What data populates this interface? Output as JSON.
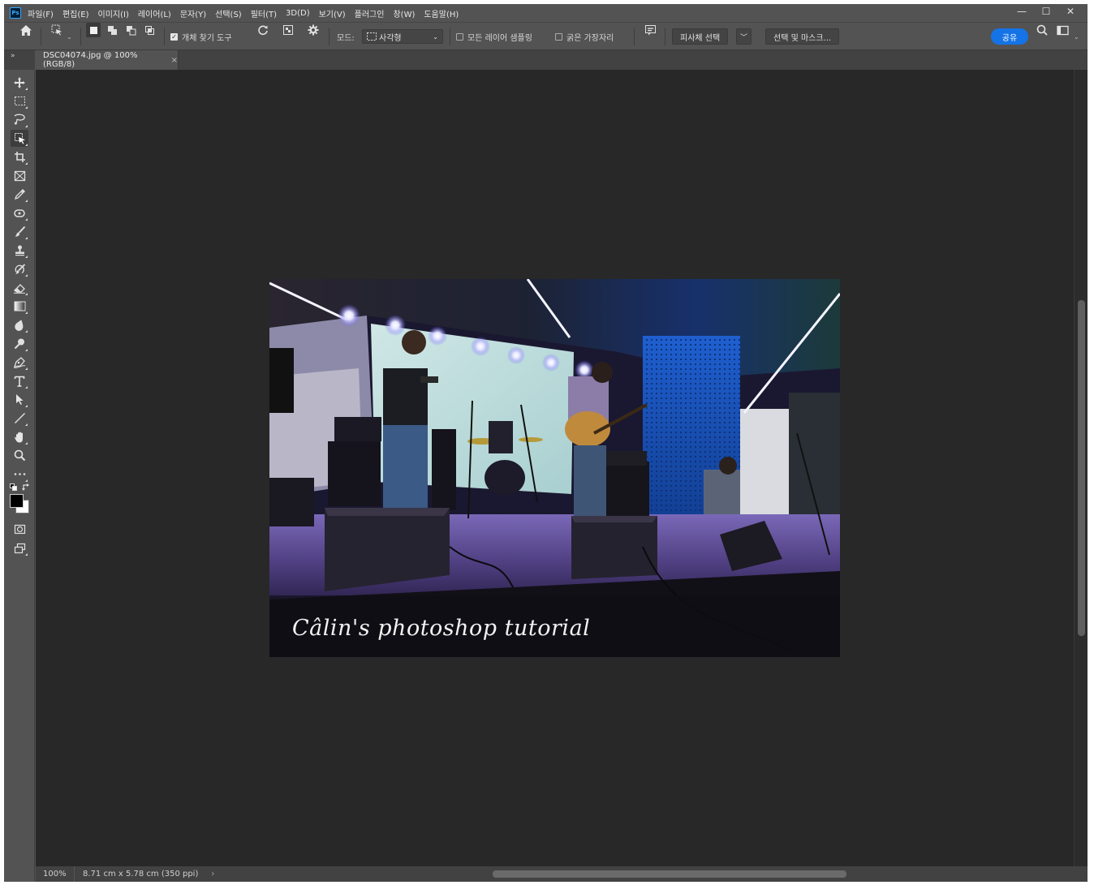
{
  "app": {
    "logo": "Ps",
    "menu": [
      "파일(F)",
      "편집(E)",
      "이미지(I)",
      "레이어(L)",
      "문자(Y)",
      "선택(S)",
      "필터(T)",
      "3D(D)",
      "보기(V)",
      "플러그인",
      "창(W)",
      "도움말(H)"
    ],
    "window_controls": {
      "minimize": "—",
      "restore": "☐",
      "close": "✕"
    }
  },
  "options": {
    "find_object_label": "개체 찾기 도구",
    "find_object_checked": true,
    "mode_label": "모드:",
    "mode_value": "사각형",
    "sample_all_layers_label": "모든 레이어 샘플링",
    "sample_all_layers_checked": false,
    "hard_edge_label": "굵은 가장자리",
    "hard_edge_checked": false,
    "select_subject_label": "피사체 선택",
    "select_and_mask_label": "선택 및 마스크...",
    "share_label": "공유"
  },
  "document": {
    "tab_title": "DSC04074.jpg @ 100% (RGB/8)",
    "tab_close": "×",
    "panel_toggle": "»",
    "watermark": "Câlin's photoshop tutorial"
  },
  "status": {
    "zoom": "100%",
    "doc_info": "8.71 cm x 5.78 cm (350 ppi)",
    "more": "›"
  },
  "tools": [
    {
      "name": "move-tool-icon"
    },
    {
      "name": "marquee-tool-icon"
    },
    {
      "name": "lasso-tool-icon"
    },
    {
      "name": "object-selection-tool-icon",
      "active": true
    },
    {
      "name": "crop-tool-icon"
    },
    {
      "name": "frame-tool-icon"
    },
    {
      "name": "eyedropper-tool-icon"
    },
    {
      "name": "healing-brush-tool-icon"
    },
    {
      "name": "brush-tool-icon"
    },
    {
      "name": "clone-stamp-tool-icon"
    },
    {
      "name": "history-brush-tool-icon"
    },
    {
      "name": "eraser-tool-icon"
    },
    {
      "name": "gradient-tool-icon"
    },
    {
      "name": "blur-tool-icon"
    },
    {
      "name": "dodge-tool-icon"
    },
    {
      "name": "pen-tool-icon"
    },
    {
      "name": "type-tool-icon"
    },
    {
      "name": "path-selection-tool-icon"
    },
    {
      "name": "line-tool-icon"
    },
    {
      "name": "hand-tool-icon"
    },
    {
      "name": "zoom-tool-icon"
    },
    {
      "name": "more-tools-icon"
    }
  ],
  "colors": {
    "foreground": "#000000",
    "background": "#ffffff",
    "accent": "#1473e6"
  }
}
